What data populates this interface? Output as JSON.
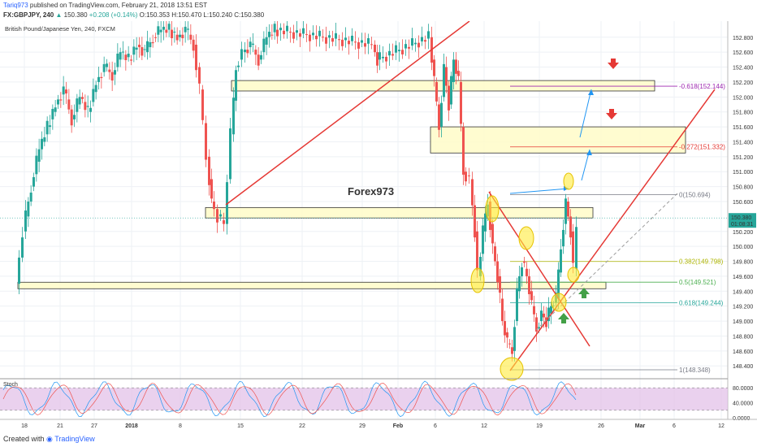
{
  "header": {
    "author": "Tariq973",
    "published": "published on TradingView.com, February 21, 2018 13:51 EST",
    "symbol": "FX:GBPJPY, 240",
    "last": "150.380",
    "change": "+0.208 (+0.14%)",
    "open": "O:150.353",
    "high": "H:150.470",
    "low": "L:150.240",
    "close": "C:150.380"
  },
  "footer": {
    "created_with": "Created with",
    "brand": "TradingView"
  },
  "chart_data": {
    "type": "candlestick",
    "title": "British Pound/Japanese Yen, 240, FXCM",
    "watermark": "Forex973",
    "x_ticks": [
      "18",
      "21",
      "27",
      "2018",
      "8",
      "15",
      "22",
      "29",
      "Feb",
      "6",
      "12",
      "19",
      "26",
      "Mar",
      "6",
      "12"
    ],
    "y_ticks": [
      "152.800",
      "152.600",
      "152.400",
      "152.200",
      "152.000",
      "151.800",
      "151.600",
      "151.400",
      "151.200",
      "151.000",
      "150.800",
      "150.600",
      "150.200",
      "150.000",
      "149.800",
      "149.600",
      "149.400",
      "149.200",
      "149.000",
      "148.800",
      "148.600",
      "148.400"
    ],
    "ylim": [
      148.25,
      152.95
    ],
    "last_price_label": "150.380",
    "last_price": 150.38,
    "countdown": "01:08:31",
    "fib_levels": [
      {
        "label": "-0.618(152.144)",
        "value": 152.144,
        "color": "#9c27b0"
      },
      {
        "label": "-0.272(151.332)",
        "value": 151.332,
        "color": "#e53935"
      },
      {
        "label": "0(150.694)",
        "value": 150.694,
        "color": "#787b86"
      },
      {
        "label": "0.382(149.798)",
        "value": 149.798,
        "color": "#aeb500"
      },
      {
        "label": "0.5(149.521)",
        "value": 149.521,
        "color": "#4caf50"
      },
      {
        "label": "0.618(149.244)",
        "value": 149.244,
        "color": "#26a69a"
      },
      {
        "label": "1(148.348)",
        "value": 148.348,
        "color": "#787b86"
      }
    ],
    "zones": [
      {
        "y1": 152.22,
        "y2": 152.08
      },
      {
        "y1": 151.6,
        "y2": 151.25
      },
      {
        "y1": 150.52,
        "y2": 150.38
      },
      {
        "y1": 149.52,
        "y2": 149.44
      }
    ],
    "stoch": {
      "label": "Stoch",
      "ticks": [
        "80.0000",
        "40.0000",
        "0.0000"
      ],
      "upper": 80,
      "lower": 20
    },
    "colors": {
      "up": "#26a69a",
      "down": "#ef5350",
      "trend": "#e53935",
      "zone": "#fffbc8",
      "stoch_band": "#e1bee7"
    }
  }
}
